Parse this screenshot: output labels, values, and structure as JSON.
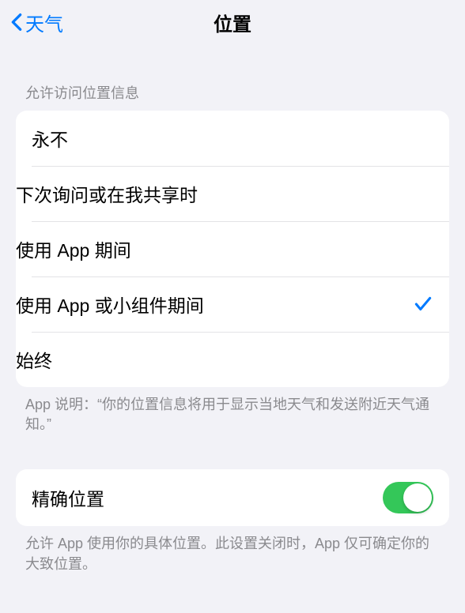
{
  "nav": {
    "back_label": "天气",
    "title": "位置"
  },
  "section1": {
    "header": "允许访问位置信息",
    "options": [
      {
        "label": "永不",
        "selected": false
      },
      {
        "label": "下次询问或在我共享时",
        "selected": false
      },
      {
        "label": "使用 App 期间",
        "selected": false
      },
      {
        "label": "使用 App 或小组件期间",
        "selected": true
      },
      {
        "label": "始终",
        "selected": false
      }
    ],
    "footer": "App 说明：“你的位置信息将用于显示当地天气和发送附近天气通知。”"
  },
  "section2": {
    "precise_location": {
      "label": "精确位置",
      "enabled": true
    },
    "footer": "允许 App 使用你的具体位置。此设置关闭时，App 仅可确定你的大致位置。"
  },
  "colors": {
    "accent": "#007aff",
    "switch_on": "#34c759",
    "background": "#f2f2f7",
    "secondary_text": "#8a8a8e"
  }
}
